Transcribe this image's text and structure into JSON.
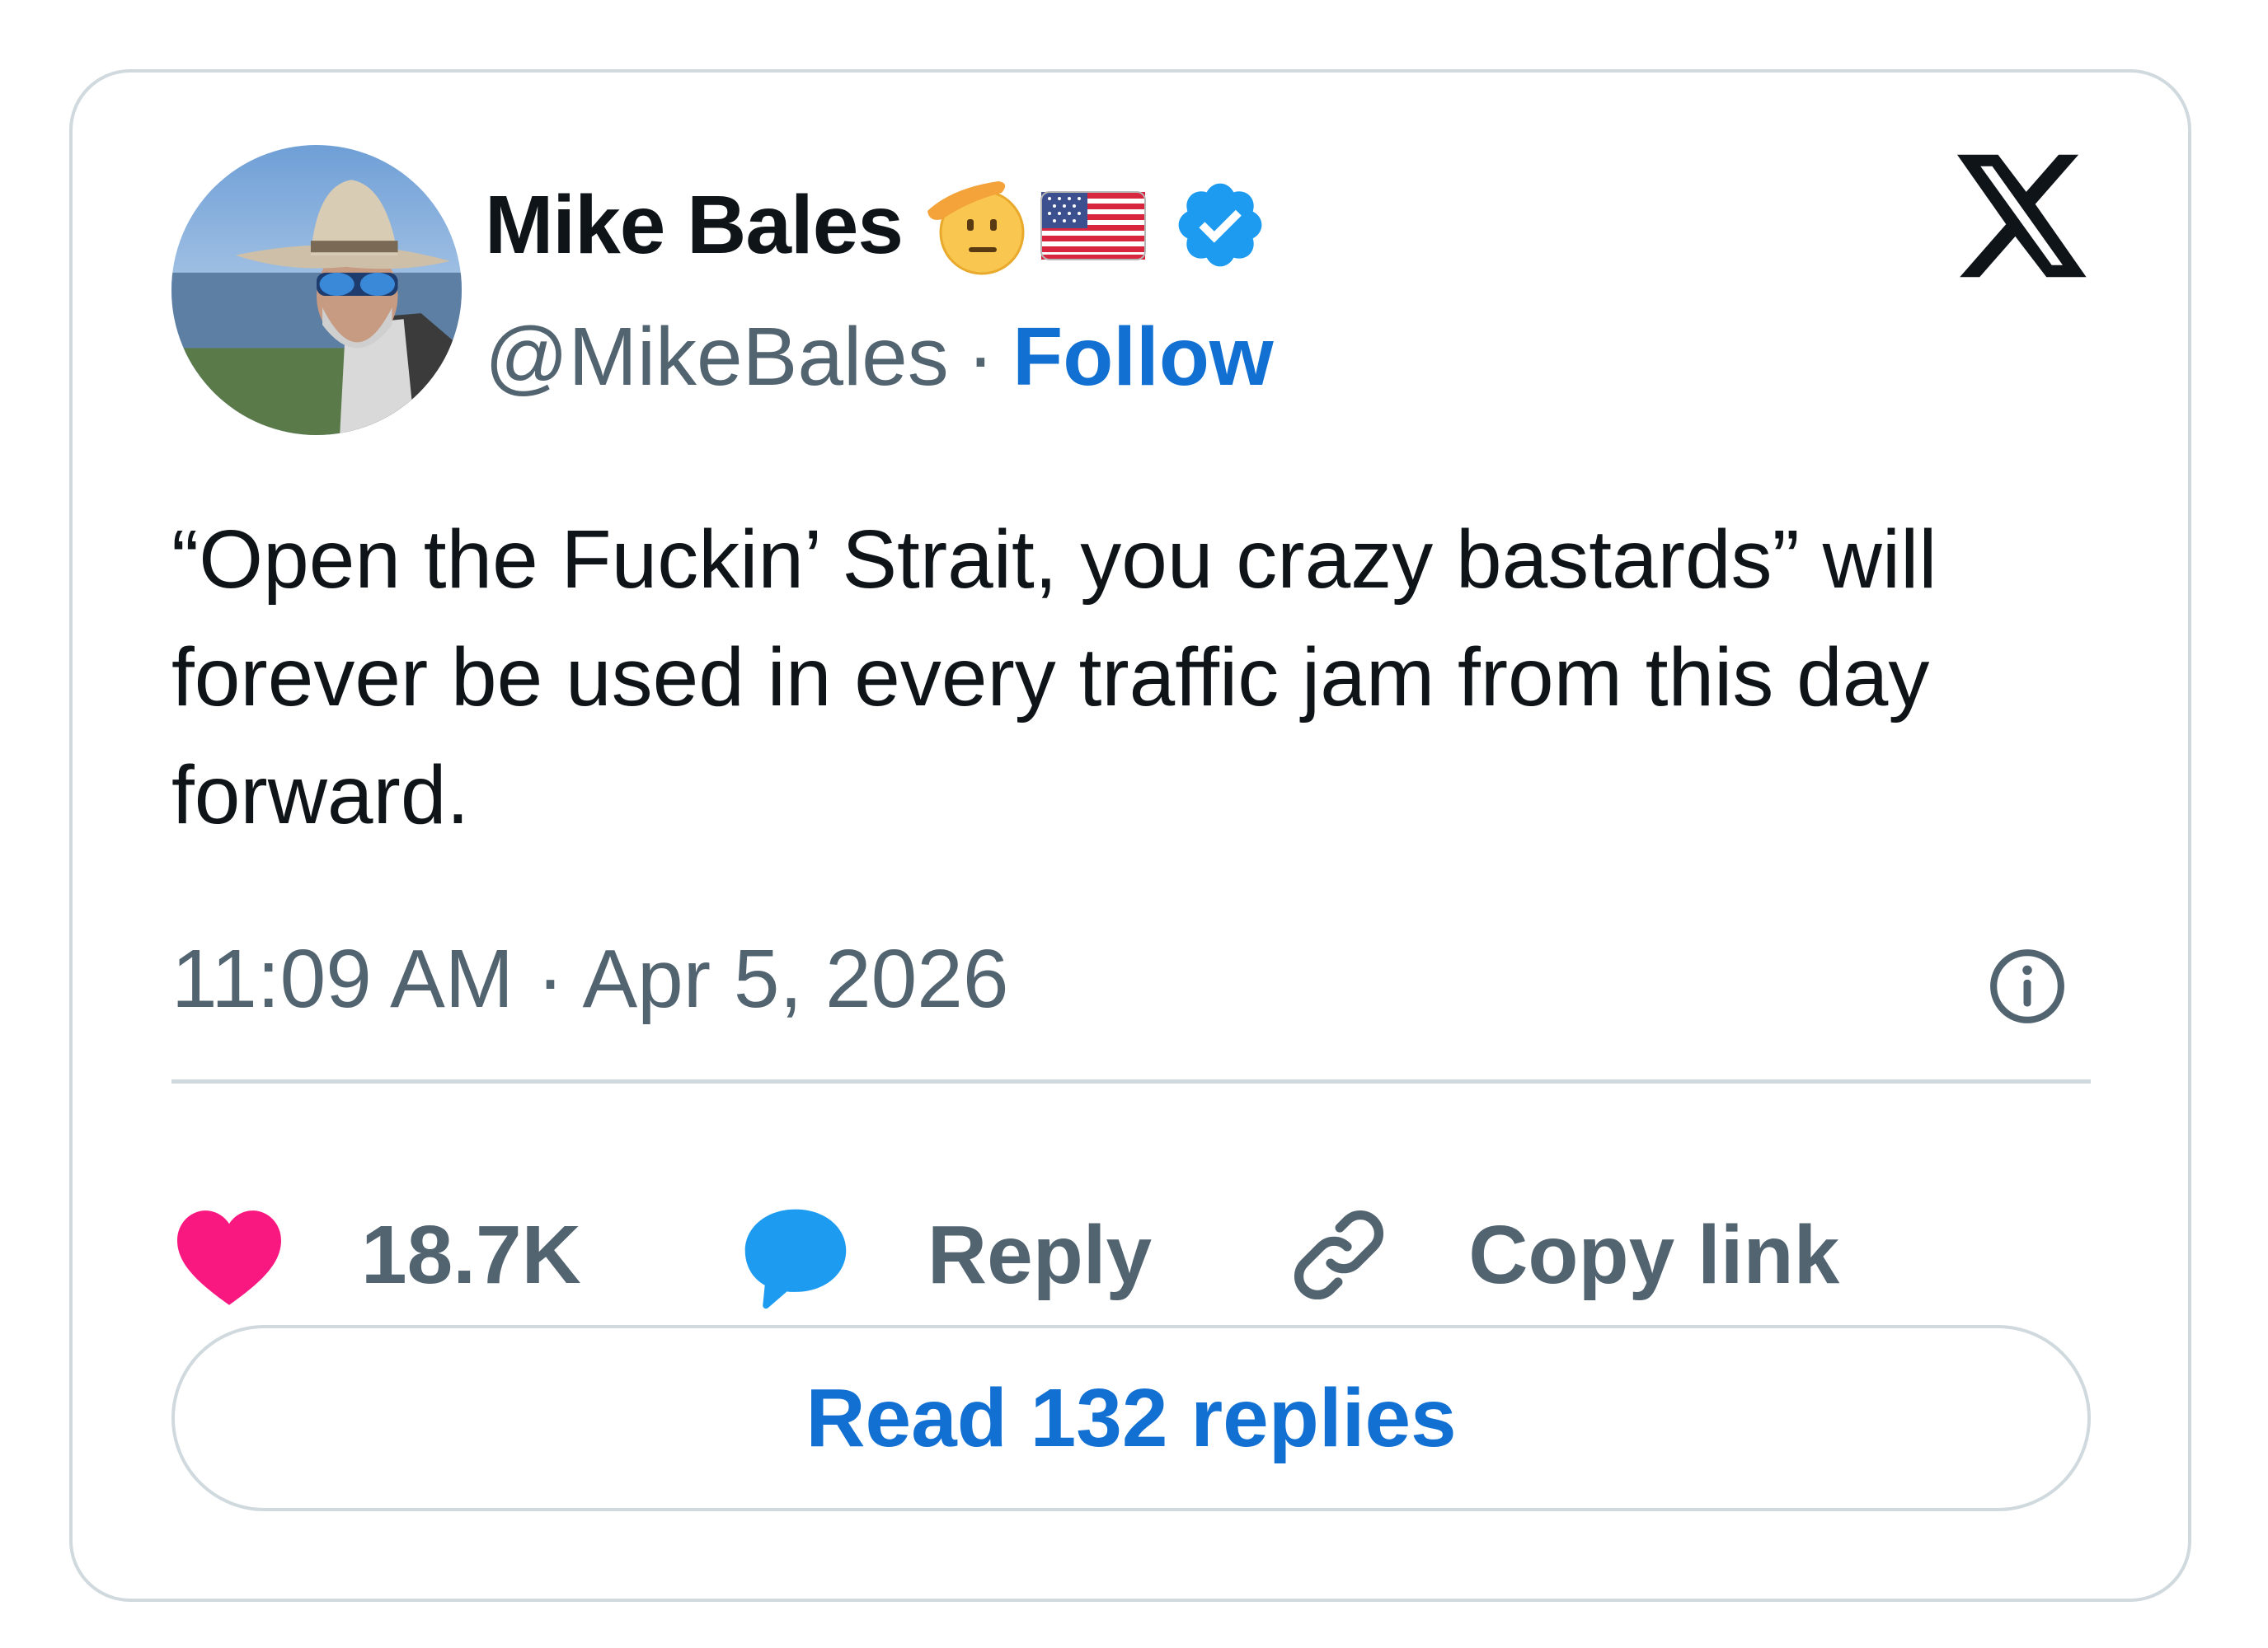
{
  "author": {
    "display_name": "Mike Bales",
    "handle": "@MikeBales",
    "separator": "·",
    "follow_label": "Follow",
    "emoji_icons": [
      "saluting-face-emoji",
      "us-flag-emoji"
    ],
    "verified_icon": "verified-badge-icon"
  },
  "tweet": {
    "text": "“Open the Fuckin’ Strait, you crazy bastards” will forever be used in every traffic jam from this day forward.",
    "timestamp": "11:09 AM · Apr 5, 2026"
  },
  "actions": {
    "like_count": "18.7K",
    "reply_label": "Reply",
    "copy_link_label": "Copy link"
  },
  "read_replies_label": "Read 132 replies",
  "colors": {
    "text": "#0f1419",
    "secondary": "#536471",
    "link_blue": "#1170d2",
    "verified_blue": "#1d9bf0",
    "like_pink": "#f91880",
    "border": "#cfd9de"
  }
}
